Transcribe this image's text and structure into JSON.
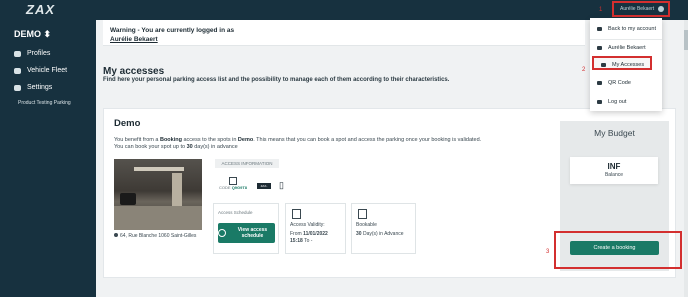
{
  "topbar": {
    "logo": "ZAX",
    "user_name": "Aurélie Bekaert",
    "annotation_1": "1"
  },
  "sidebar": {
    "brand": "DEMO",
    "items": [
      {
        "label": "Profiles",
        "icon": "users-icon"
      },
      {
        "label": "Vehicle Fleet",
        "icon": "car-icon"
      },
      {
        "label": "Settings",
        "icon": "gear-icon"
      }
    ],
    "sub_item": "Product Testing Parking"
  },
  "warning": {
    "line1": "Warning - You are currently logged in as",
    "user": "Aurélie Bekaert"
  },
  "page": {
    "title": "My accesses",
    "subtitle": "Find here your personal parking access list and the possibility to manage each of them according to their characteristics.",
    "annotation_2": "2",
    "annotation_3": "3"
  },
  "card": {
    "title": "Demo",
    "text_1a": "You benefit from a ",
    "text_1b": "Booking",
    "text_1c": " access to the spots in ",
    "text_1d": "Demo",
    "text_1e": ". This means that you can book a spot and access the parking once your booking is validated.",
    "text_2a": "You can book your spot up to ",
    "text_2b": "30",
    "text_2c": " day(s) in advance",
    "address": "64, Rue Blanche 1060 Saint-Gilles",
    "access_info_label": "ACCESS INFORMATION",
    "code_label": "CODE",
    "code_value": "Q9G9T8",
    "badge_text": "ZAX-BADGE"
  },
  "boxes": {
    "schedule_label": "Access Schedule",
    "view_btn": "View access schedule",
    "validity_label": "Access Validity:",
    "validity_from": "From",
    "validity_date": "11/01/2022",
    "validity_time": "15:18",
    "validity_to": "To -",
    "bookable_label": "Bookable",
    "bookable_days": "30",
    "bookable_suffix": "Day(s) in Advance"
  },
  "budget": {
    "title": "My Budget",
    "value": "INF",
    "label": "Balance",
    "create_btn": "Create a booking"
  },
  "dropdown": {
    "items": [
      {
        "label": "Back to my account",
        "icon": "eye-icon"
      },
      {
        "label": "Aurélie Bekaert",
        "icon": "user-icon"
      },
      {
        "label": "My Accesses",
        "icon": "box-icon"
      },
      {
        "label": "QR Code",
        "icon": "qr-icon"
      },
      {
        "label": "Log out",
        "icon": "power-icon"
      }
    ]
  }
}
